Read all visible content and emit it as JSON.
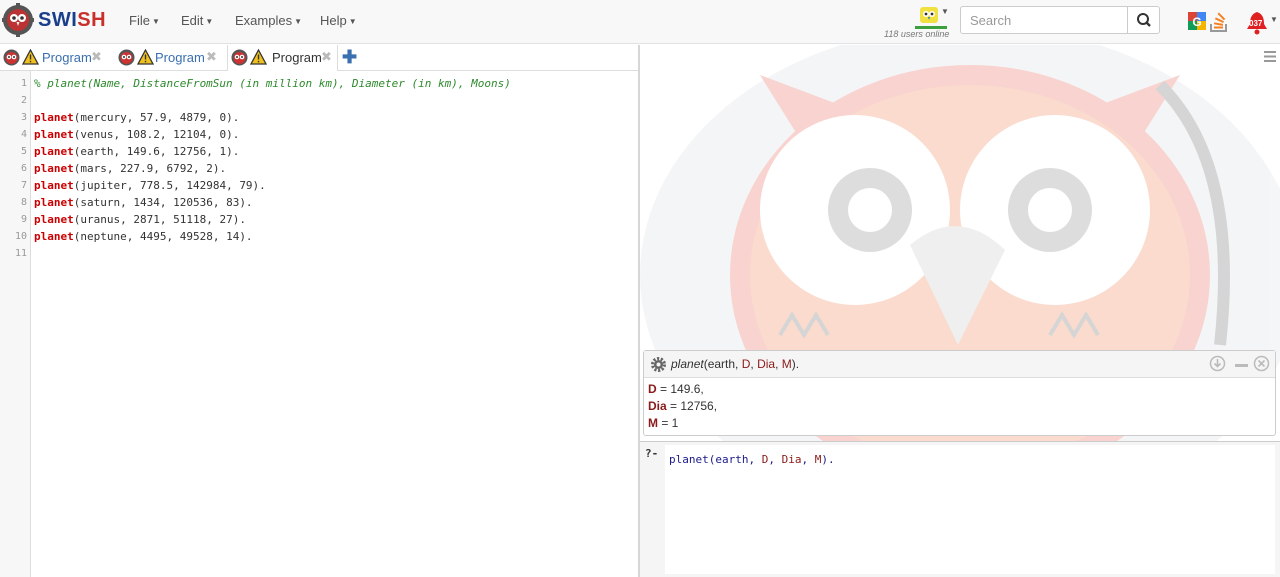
{
  "app": {
    "brand_a": "SWI",
    "brand_b": "SH"
  },
  "menu": {
    "file": "File",
    "edit": "Edit",
    "examples": "Examples",
    "help": "Help"
  },
  "online": {
    "text": "118 users online"
  },
  "search": {
    "placeholder": "Search"
  },
  "notifications": {
    "badge": "037"
  },
  "tabs": [
    {
      "label": "Program",
      "active": false
    },
    {
      "label": "Program",
      "active": false
    },
    {
      "label": "Program",
      "active": true
    }
  ],
  "editor": {
    "line_numbers": [
      "1",
      "2",
      "3",
      "4",
      "5",
      "6",
      "7",
      "8",
      "9",
      "10",
      "11"
    ],
    "comment": "% planet(Name, DistanceFromSun (in million km), Diameter (in km), Moons)",
    "facts": [
      {
        "pred": "planet",
        "args": "(mercury, 57.9, 4879, 0)."
      },
      {
        "pred": "planet",
        "args": "(venus, 108.2, 12104, 0)."
      },
      {
        "pred": "planet",
        "args": "(earth, 149.6, 12756, 1)."
      },
      {
        "pred": "planet",
        "args": "(mars, 227.9, 6792, 2)."
      },
      {
        "pred": "planet",
        "args": "(jupiter, 778.5, 142984, 79)."
      },
      {
        "pred": "planet",
        "args": "(saturn, 1434, 120536, 83)."
      },
      {
        "pred": "planet",
        "args": "(uranus, 2871, 51118, 27)."
      },
      {
        "pred": "planet",
        "args": "(neptune, 4495, 49528, 14)."
      }
    ]
  },
  "answer": {
    "query_pred": "planet",
    "query_open": "(earth, ",
    "query_vars": [
      "D",
      "Dia",
      "M"
    ],
    "query_close": ").",
    "bindings": [
      {
        "var": "D",
        "value": " = 149.6,"
      },
      {
        "var": "Dia",
        "value": " = 12756,"
      },
      {
        "var": "M",
        "value": " = 1"
      }
    ]
  },
  "query": {
    "prompt": "?-",
    "text_pre": "planet(earth, ",
    "vars": [
      "D",
      "Dia",
      "M"
    ],
    "text_post": ")."
  },
  "icons": [
    "swish-logo-icon",
    "owl-icon",
    "warning-icon",
    "close-icon",
    "plus-icon",
    "search-icon",
    "google-icon",
    "stackoverflow-icon",
    "bell-icon",
    "gear-icon",
    "download-icon",
    "minimize-icon",
    "hamburger-icon"
  ],
  "colors": {
    "brand_blue": "#1a3f8a",
    "brand_red": "#c9302c",
    "predicate": "#cc0000",
    "comment": "#2d8a2d",
    "variable": "#8b1a1a",
    "link": "#3a6fb0"
  }
}
